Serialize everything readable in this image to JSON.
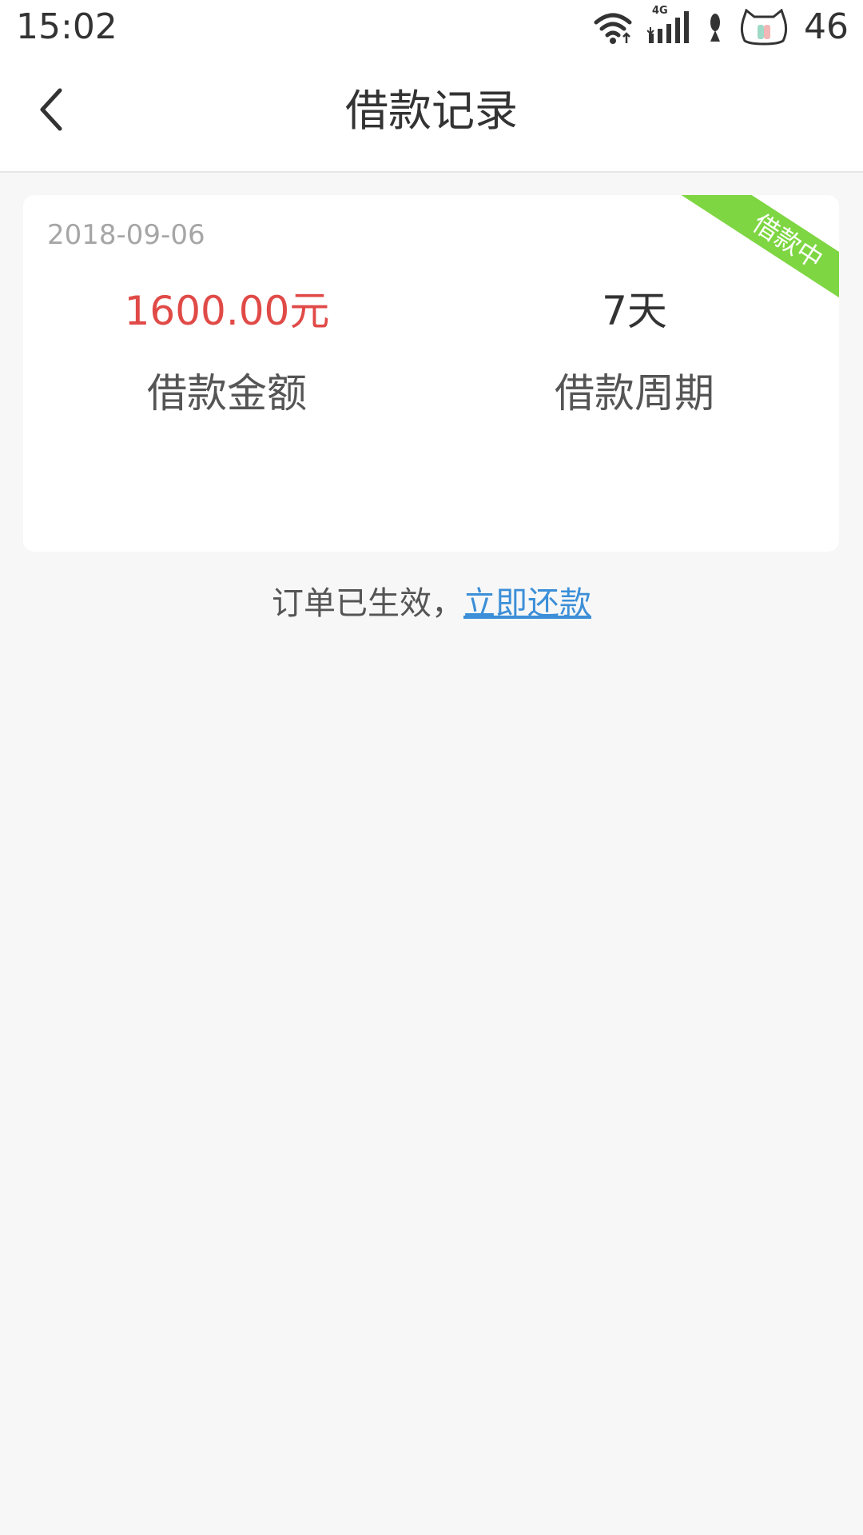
{
  "status_bar": {
    "time": "15:02",
    "network": "4G",
    "battery": "46",
    "icons": [
      "wifi-icon",
      "signal-4g-icon",
      "fish-icon",
      "cat-battery-icon"
    ]
  },
  "header": {
    "title": "借款记录",
    "back_icon": "chevron-left-icon"
  },
  "loan_card": {
    "date": "2018-09-06",
    "status_ribbon": "借款中",
    "amount_value": "1600.00元",
    "amount_label": "借款金额",
    "period_value": "7天",
    "period_label": "借款周期"
  },
  "order_status": {
    "text": "订单已生效，",
    "link_text": "立即还款"
  },
  "colors": {
    "amount_red": "#e04a47",
    "ribbon_green": "#7ed642",
    "link_blue": "#3c8fd8",
    "background": "#f7f7f7"
  }
}
